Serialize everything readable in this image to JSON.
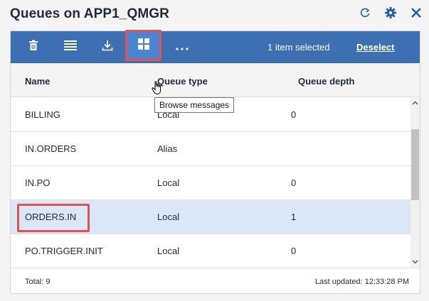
{
  "title": "Queues on APP1_QMGR",
  "title_actions": [
    {
      "icon": "refresh-icon"
    },
    {
      "icon": "gear-icon"
    },
    {
      "icon": "close-icon"
    }
  ],
  "toolbar": {
    "buttons": [
      {
        "icon": "trash-icon"
      },
      {
        "icon": "list-icon"
      },
      {
        "icon": "download-icon"
      },
      {
        "icon": "grid-icon",
        "active": true
      },
      {
        "icon": "more-icon"
      }
    ],
    "selection_text": "1 item selected",
    "deselect_label": "Deselect"
  },
  "tooltip": "Browse messages",
  "table": {
    "columns": [
      "Name",
      "Queue type",
      "Queue depth"
    ],
    "rows": [
      {
        "name": "BILLING",
        "type": "Local",
        "depth": "0"
      },
      {
        "name": "IN.ORDERS",
        "type": "Alias",
        "depth": ""
      },
      {
        "name": "IN.PO",
        "type": "Local",
        "depth": "0"
      },
      {
        "name": "ORDERS.IN",
        "type": "Local",
        "depth": "1",
        "selected": true
      },
      {
        "name": "PO.TRIGGER.INIT",
        "type": "Local",
        "depth": "0"
      }
    ]
  },
  "footer": {
    "total": "Total: 9",
    "last_updated": "Last updated: 12:33:28 PM"
  },
  "colors": {
    "toolbar": "#3d70b2",
    "highlight": "#e05252",
    "selected_row": "#dbe6f6",
    "title_icons": "#1f5fa8"
  }
}
